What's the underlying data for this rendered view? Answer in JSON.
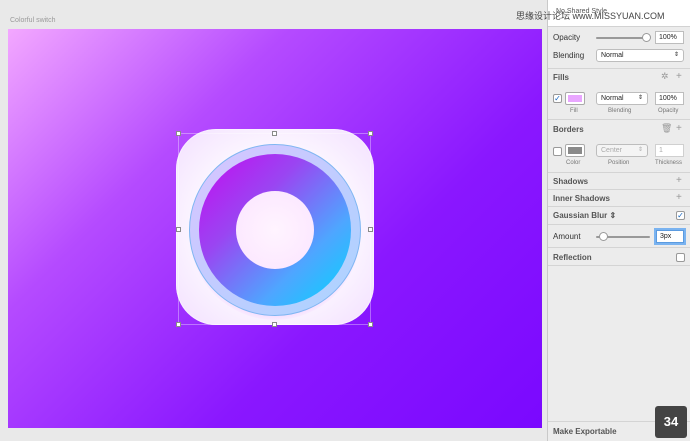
{
  "artboard": {
    "title": "Colorful switch"
  },
  "watermark": "思缘设计论坛 www.MISSYUAN.COM",
  "style_picker": {
    "label": "No Shared Style"
  },
  "opacity": {
    "label": "Opacity",
    "value": "100%",
    "level": 1.0
  },
  "blending": {
    "label": "Blending",
    "value": "Normal"
  },
  "fills": {
    "header": "Fills",
    "checked": true,
    "color": "#e9a6ff",
    "blend": "Normal",
    "opacity": "100%",
    "labels": {
      "fill": "Fill",
      "blending": "Blending",
      "opacity": "Opacity"
    }
  },
  "borders": {
    "header": "Borders",
    "checked": false,
    "color": "#8a8a8a",
    "position": "Center",
    "thickness": "1",
    "labels": {
      "color": "Color",
      "position": "Position",
      "thickness": "Thickness"
    }
  },
  "shadows": {
    "header": "Shadows"
  },
  "inner_shadows": {
    "header": "Inner Shadows"
  },
  "gaussian_blur": {
    "header": "Gaussian Blur",
    "checked": true
  },
  "amount": {
    "label": "Amount",
    "value": "3px",
    "level": 0.05
  },
  "reflection": {
    "header": "Reflection",
    "checked": false
  },
  "exportable": {
    "label": "Make Exportable"
  },
  "page_badge": "34",
  "colors": {
    "accent": "#7a08ff",
    "check": "#1565c0"
  }
}
